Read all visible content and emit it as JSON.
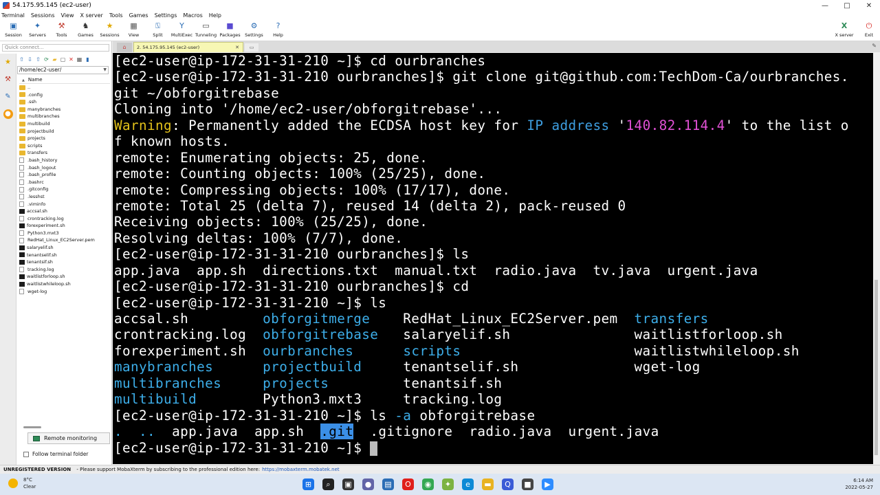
{
  "window": {
    "title": "54.175.95.145 (ec2-user)",
    "minimize": "—",
    "maximize": "□",
    "close": "✕"
  },
  "menu": [
    "Terminal",
    "Sessions",
    "View",
    "X server",
    "Tools",
    "Games",
    "Settings",
    "Macros",
    "Help"
  ],
  "toolbar": {
    "buttons": [
      {
        "label": "Session",
        "icon": "session-icon",
        "glyph": "▣",
        "color": "#2b6db5"
      },
      {
        "label": "Servers",
        "icon": "servers-icon",
        "glyph": "✦",
        "color": "#2b6db5"
      },
      {
        "label": "Tools",
        "icon": "tools-icon",
        "glyph": "⚒",
        "color": "#c0392b"
      },
      {
        "label": "Games",
        "icon": "games-icon",
        "glyph": "♞",
        "color": "#333333"
      },
      {
        "label": "Sessions",
        "icon": "star-icon",
        "glyph": "★",
        "color": "#e0a800"
      },
      {
        "label": "View",
        "icon": "view-icon",
        "glyph": "▦",
        "color": "#555555"
      },
      {
        "label": "Split",
        "icon": "split-icon",
        "glyph": "⍂",
        "color": "#2b6db5"
      },
      {
        "label": "MultiExec",
        "icon": "multiexec-icon",
        "glyph": "Y",
        "color": "#2b6db5"
      },
      {
        "label": "Tunneling",
        "icon": "tunneling-icon",
        "glyph": "▭",
        "color": "#444444"
      },
      {
        "label": "Packages",
        "icon": "packages-icon",
        "glyph": "■",
        "color": "#5a4bd1"
      },
      {
        "label": "Settings",
        "icon": "settings-icon",
        "glyph": "⚙",
        "color": "#2b6db5"
      },
      {
        "label": "Help",
        "icon": "help-icon",
        "glyph": "?",
        "color": "#2b6db5"
      }
    ],
    "xserver": {
      "label": "X server",
      "glyph": "X",
      "color": "#2e8b57"
    },
    "exit": {
      "label": "Exit",
      "glyph": "⏻",
      "color": "#d9302b"
    }
  },
  "sidebar": {
    "quick_connect_placeholder": "Quick connect...",
    "path": "/home/ec2-user/",
    "column_header": "Name",
    "files": [
      {
        "name": "..",
        "type": "up"
      },
      {
        "name": ".config",
        "type": "folder"
      },
      {
        "name": ".ssh",
        "type": "folder"
      },
      {
        "name": "manybranches",
        "type": "folder"
      },
      {
        "name": "multibranches",
        "type": "folder"
      },
      {
        "name": "multibuild",
        "type": "folder"
      },
      {
        "name": "projectbuild",
        "type": "folder"
      },
      {
        "name": "projects",
        "type": "folder"
      },
      {
        "name": "scripts",
        "type": "folder"
      },
      {
        "name": "transfers",
        "type": "folder"
      },
      {
        "name": ".bash_history",
        "type": "file"
      },
      {
        "name": ".bash_logout",
        "type": "file"
      },
      {
        "name": ".bash_profile",
        "type": "file"
      },
      {
        "name": ".bashrc",
        "type": "file"
      },
      {
        "name": ".gitconfig",
        "type": "file"
      },
      {
        "name": ".lesshst",
        "type": "file"
      },
      {
        "name": ".viminfo",
        "type": "file"
      },
      {
        "name": "accsal.sh",
        "type": "exe"
      },
      {
        "name": "crontracking.log",
        "type": "file"
      },
      {
        "name": "forexperiment.sh",
        "type": "exe"
      },
      {
        "name": "Python3.mxt3",
        "type": "file"
      },
      {
        "name": "RedHat_Linux_EC2Server.pem",
        "type": "file"
      },
      {
        "name": "salaryelif.sh",
        "type": "exe"
      },
      {
        "name": "tenantselif.sh",
        "type": "exe"
      },
      {
        "name": "tenantsif.sh",
        "type": "exe"
      },
      {
        "name": "tracking.log",
        "type": "file"
      },
      {
        "name": "waitlistforloop.sh",
        "type": "exe"
      },
      {
        "name": "waitlistwhileloop.sh",
        "type": "exe"
      },
      {
        "name": "wget-log",
        "type": "file"
      }
    ],
    "remote_monitoring": "Remote monitoring",
    "follow_folder": "Follow terminal folder"
  },
  "tabs": {
    "session_tab": "2. 54.175.95.145 (ec2-user)",
    "close": "✕"
  },
  "terminal": {
    "lines": [
      [
        {
          "t": "[ec2-user@ip-172-31-31-210 ~]$ cd ourbranches"
        }
      ],
      [
        {
          "t": "[ec2-user@ip-172-31-31-210 ourbranches]$ git clone git@github.com:TechDom-Ca/ourbranches."
        }
      ],
      [
        {
          "t": "git ~/obforgitrebase"
        }
      ],
      [
        {
          "t": "Cloning into '/home/ec2-user/obforgitrebase'..."
        }
      ],
      [
        {
          "t": "Warning",
          "c": "c-yellow"
        },
        {
          "t": ": Permanently added the ECDSA host key for "
        },
        {
          "t": "IP address",
          "c": "c-blue"
        },
        {
          "t": " '"
        },
        {
          "t": "140.82.114.4",
          "c": "c-magenta"
        },
        {
          "t": "' to the list o"
        }
      ],
      [
        {
          "t": "f known hosts."
        }
      ],
      [
        {
          "t": "remote: Enumerating objects: 25, done."
        }
      ],
      [
        {
          "t": "remote: Counting objects: 100% (25/25), done."
        }
      ],
      [
        {
          "t": "remote: Compressing objects: 100% (17/17), done."
        }
      ],
      [
        {
          "t": "remote: Total 25 (delta 7), reused 14 (delta 2), pack-reused 0"
        }
      ],
      [
        {
          "t": "Receiving objects: 100% (25/25), done."
        }
      ],
      [
        {
          "t": "Resolving deltas: 100% (7/7), done."
        }
      ],
      [
        {
          "t": "[ec2-user@ip-172-31-31-210 ourbranches]$ ls"
        }
      ],
      [
        {
          "t": "app.java  app.sh  directions.txt  manual.txt  radio.java  tv.java  urgent.java"
        }
      ],
      [
        {
          "t": "[ec2-user@ip-172-31-31-210 ourbranches]$ cd"
        }
      ],
      [
        {
          "t": "[ec2-user@ip-172-31-31-210 ~]$ ls"
        }
      ],
      [
        {
          "t": "accsal.sh         "
        },
        {
          "t": "obforgitmerge",
          "c": "c-dir"
        },
        {
          "t": "    RedHat_Linux_EC2Server.pem  "
        },
        {
          "t": "transfers",
          "c": "c-dir"
        }
      ],
      [
        {
          "t": "crontracking.log  "
        },
        {
          "t": "obforgitrebase",
          "c": "c-dir"
        },
        {
          "t": "   salaryelif.sh               waitlistforloop.sh"
        }
      ],
      [
        {
          "t": "forexperiment.sh  "
        },
        {
          "t": "ourbranches",
          "c": "c-dir"
        },
        {
          "t": "      "
        },
        {
          "t": "scripts",
          "c": "c-dir"
        },
        {
          "t": "                     waitlistwhileloop.sh"
        }
      ],
      [
        {
          "t": "manybranches",
          "c": "c-dir"
        },
        {
          "t": "      "
        },
        {
          "t": "projectbuild",
          "c": "c-dir"
        },
        {
          "t": "     tenantselif.sh              wget-log"
        }
      ],
      [
        {
          "t": "multibranches",
          "c": "c-dir"
        },
        {
          "t": "     "
        },
        {
          "t": "projects",
          "c": "c-dir"
        },
        {
          "t": "         tenantsif.sh"
        }
      ],
      [
        {
          "t": "multibuild",
          "c": "c-dir"
        },
        {
          "t": "        Python3.mxt3     tracking.log"
        }
      ],
      [
        {
          "t": "[ec2-user@ip-172-31-31-210 ~]$ ls "
        },
        {
          "t": "-a",
          "c": "c-dir"
        },
        {
          "t": " obforgitrebase"
        }
      ],
      [
        {
          "t": ".",
          "c": "c-dir"
        },
        {
          "t": "  "
        },
        {
          "t": "..",
          "c": "c-dir"
        },
        {
          "t": "  app.java  app.sh  "
        },
        {
          "t": ".git",
          "c": "hl"
        },
        {
          "t": "  .gitignore  radio.java  urgent.java"
        }
      ],
      [
        {
          "t": "[ec2-user@ip-172-31-31-210 ~]$ "
        },
        {
          "cursor": true
        }
      ]
    ]
  },
  "status": {
    "edition": "UNREGISTERED VERSION",
    "message": "  -  Please support MobaXterm by subscribing to the professional edition here:",
    "link": "https://mobaxterm.mobatek.net"
  },
  "taskbar": {
    "weather_temp": "8°C",
    "weather_desc": "Clear",
    "time": "6:14 AM",
    "date": "2022-05-27",
    "apps": [
      {
        "name": "windows-start-icon",
        "glyph": "⊞",
        "color": "#1a73e8"
      },
      {
        "name": "search-icon",
        "glyph": "⌕",
        "color": "#222222"
      },
      {
        "name": "task-view-icon",
        "glyph": "▣",
        "color": "#333333"
      },
      {
        "name": "teams-icon",
        "glyph": "●",
        "color": "#6264a7"
      },
      {
        "name": "widgets-icon",
        "glyph": "▤",
        "color": "#2b6db5"
      },
      {
        "name": "opera-icon",
        "glyph": "O",
        "color": "#e0201b"
      },
      {
        "name": "chrome-icon",
        "glyph": "◉",
        "color": "#34a853"
      },
      {
        "name": "app-icon",
        "glyph": "✦",
        "color": "#7cb342"
      },
      {
        "name": "edge-icon",
        "glyph": "e",
        "color": "#0c8ad6"
      },
      {
        "name": "file-explorer-icon",
        "glyph": "▬",
        "color": "#e8b322"
      },
      {
        "name": "search-app-icon",
        "glyph": "Q",
        "color": "#3a5bd6"
      },
      {
        "name": "mobaxterm-icon",
        "glyph": "■",
        "color": "#444444"
      },
      {
        "name": "zoom-icon",
        "glyph": "▶",
        "color": "#2d8cff"
      }
    ]
  }
}
